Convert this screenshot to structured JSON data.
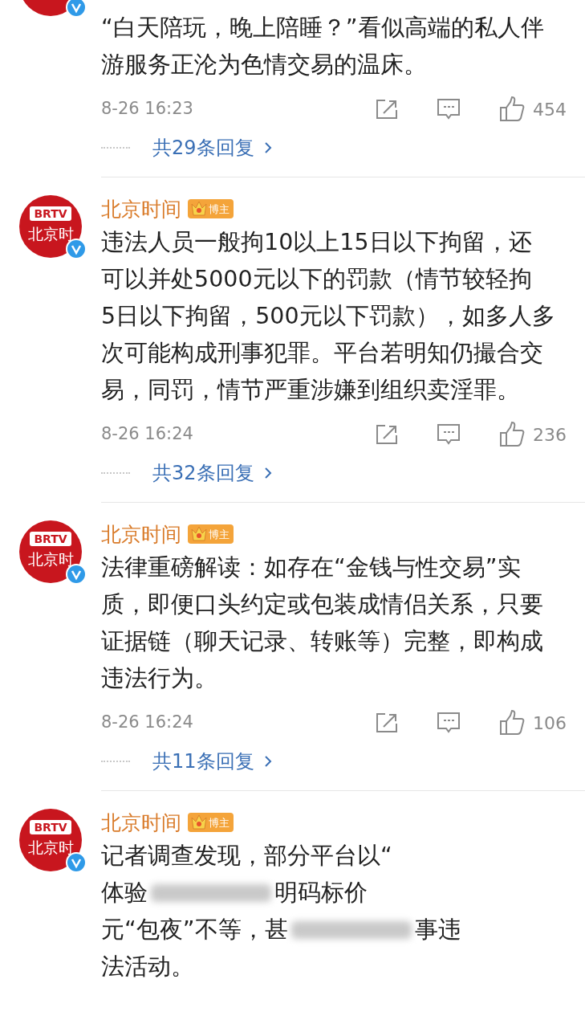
{
  "comments": [
    {
      "verified": true,
      "lines": [
        [
          "“白天陪玩，晚上陪睡？”看似高端的私人伴"
        ],
        [
          "游服务正沦为色情交易的温床。"
        ]
      ],
      "time": "8-26 16:23",
      "likes": "454",
      "replies": "共29条回复"
    },
    {
      "author": "北京时间",
      "role": "博主",
      "avatar": {
        "badge": "BRTV",
        "caption": "北京时"
      },
      "verified": true,
      "lines": [
        [
          "违法人员一般拘10以上15日以下拘留，还"
        ],
        [
          "可以并处5000元以下的罚款（情节较轻拘"
        ],
        [
          "5日以下拘留，500元以下罚款），如多人多"
        ],
        [
          "次可能构成刑事犯罪。平台若明知仍撮合交"
        ],
        [
          "易，同罚，情节严重涉嫌到组织卖淫罪。"
        ]
      ],
      "time": "8-26 16:24",
      "likes": "236",
      "replies": "共32条回复"
    },
    {
      "author": "北京时间",
      "role": "博主",
      "avatar": {
        "badge": "BRTV",
        "caption": "北京时"
      },
      "verified": true,
      "lines": [
        [
          "法律重磅解读：如存在“金钱与性交易”实"
        ],
        [
          "质，即便口头约定或包装成情侣关系，只要"
        ],
        [
          "证据链（聊天记录、转账等）完整，即构成"
        ],
        [
          "违法行为。"
        ]
      ],
      "time": "8-26 16:24",
      "likes": "106",
      "replies": "共11条回复"
    },
    {
      "author": "北京时间",
      "role": "博主",
      "avatar": {
        "badge": "BRTV",
        "caption": "北京时"
      },
      "verified": true,
      "lines": [
        [
          "记者调查发现，部分平台以“"
        ],
        [
          "体验",
          "明码标价"
        ],
        [
          "元“包夜”不等，甚",
          "事违"
        ],
        [
          "法活动。"
        ]
      ]
    }
  ]
}
